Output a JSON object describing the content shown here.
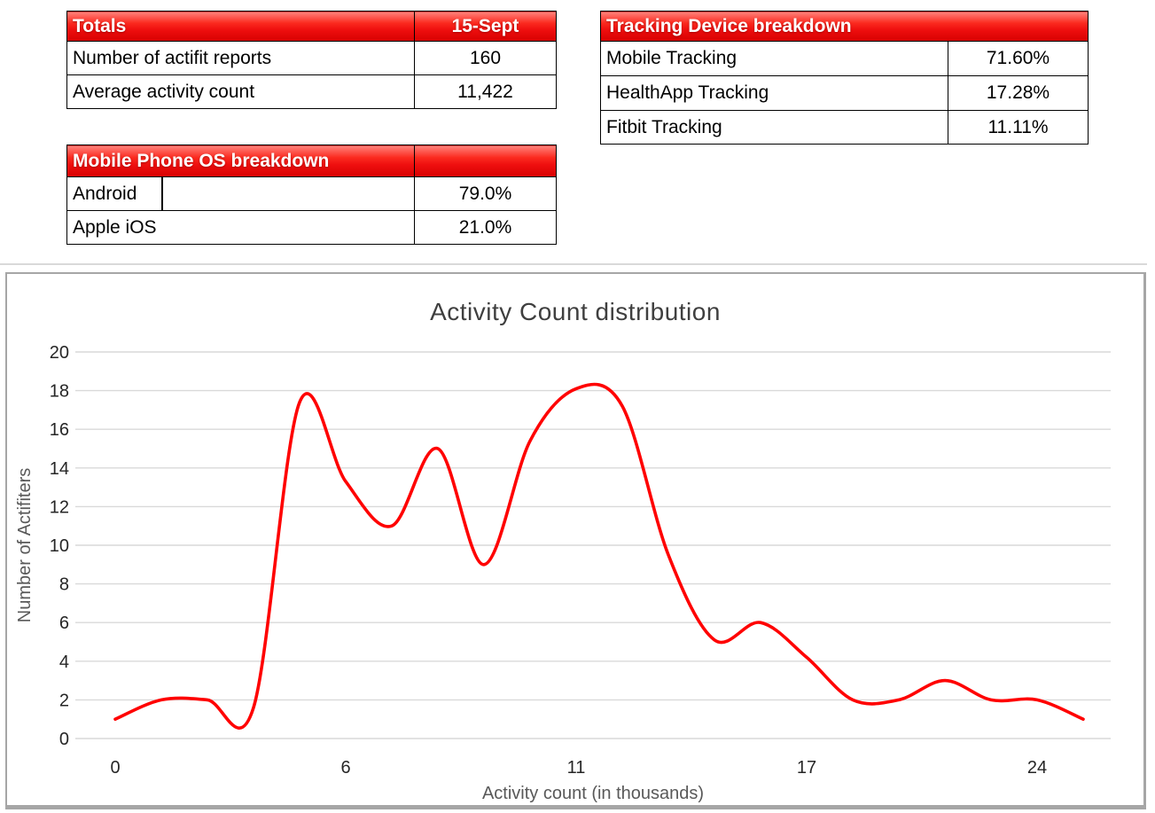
{
  "tables": {
    "totals": {
      "header": {
        "label": "Totals",
        "value": "15-Sept"
      },
      "rows": [
        {
          "label": "Number of actifit reports",
          "value": "160"
        },
        {
          "label": "Average activity count",
          "value": "11,422"
        }
      ]
    },
    "tracking": {
      "header": {
        "label": "Tracking Device breakdown"
      },
      "rows": [
        {
          "label": "Mobile Tracking",
          "value": "71.60%"
        },
        {
          "label": "HealthApp Tracking",
          "value": "17.28%"
        },
        {
          "label": "Fitbit Tracking",
          "value": "11.11%"
        }
      ]
    },
    "os": {
      "header": {
        "label": "Mobile Phone OS breakdown",
        "value": ""
      },
      "rows": [
        {
          "label": "Android",
          "value": "79.0%"
        },
        {
          "label": "Apple iOS",
          "value": "21.0%"
        }
      ]
    }
  },
  "colors": {
    "line": "#ff0000",
    "gridline": "#d9d9d9",
    "tick_text": "#262626",
    "axis_title_text": "#595959",
    "chart_title_text": "#3f3f3f",
    "table_border": "#000000",
    "header_red_top": "#ff837c",
    "header_red_bottom": "#d60000",
    "chart_frame": "#a6a6a6"
  },
  "chart_data": {
    "type": "line",
    "smooth": true,
    "title": "Activity Count distribution",
    "xlabel": "Activity count (in thousands)",
    "ylabel": "Number of Actifiters",
    "ylim": [
      0,
      20
    ],
    "y_ticks": [
      0,
      2,
      4,
      6,
      8,
      10,
      12,
      14,
      16,
      18,
      20
    ],
    "x_tick_labels": [
      "0",
      "6",
      "11",
      "17",
      "24"
    ],
    "x_tick_indices": [
      0,
      5,
      10,
      15,
      20
    ],
    "grid": true,
    "legend": false,
    "series": [
      {
        "name": "Number of Actifiters",
        "values": [
          1,
          2,
          2,
          1.6,
          17.4,
          13.3,
          11,
          15,
          9,
          15.4,
          18.1,
          17.2,
          9.5,
          5.1,
          6,
          4.2,
          2,
          2,
          3,
          2,
          2,
          1
        ]
      }
    ]
  }
}
